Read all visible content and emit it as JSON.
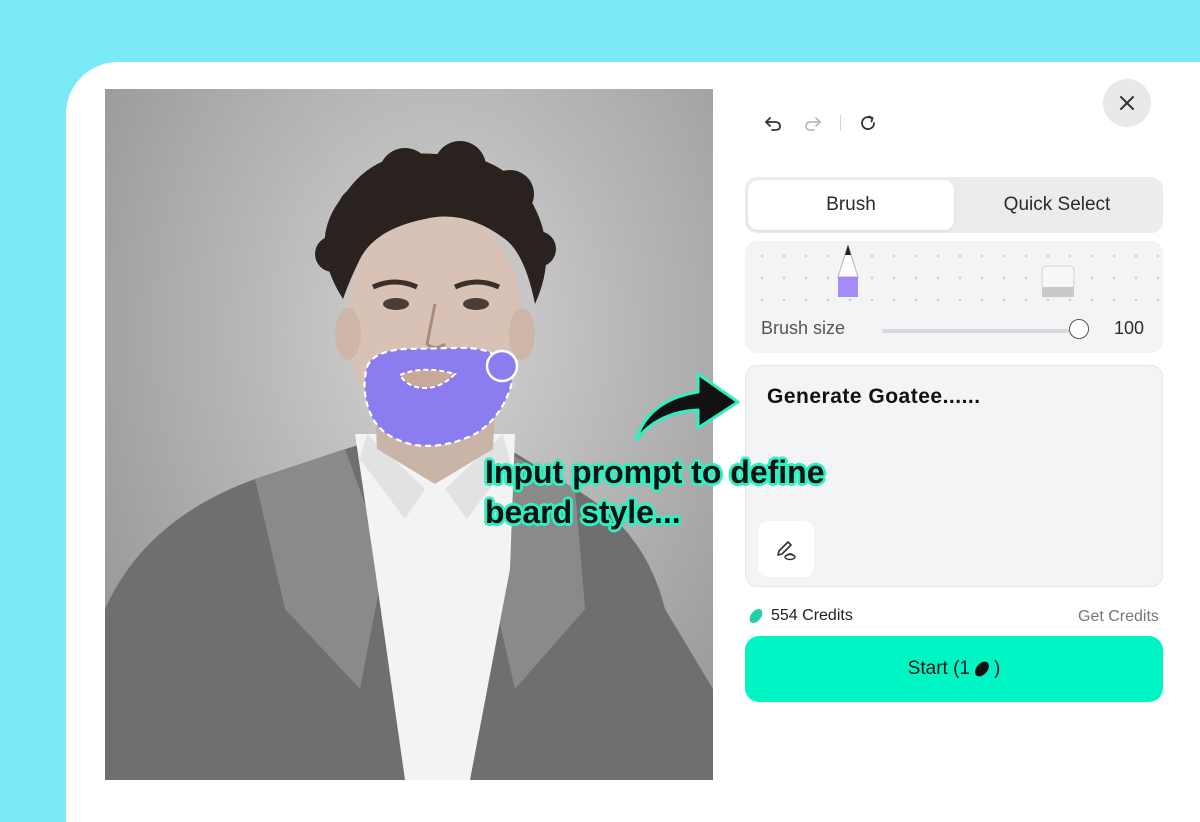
{
  "toolbar": {
    "undo_icon": "undo-icon",
    "redo_icon": "redo-icon",
    "reset_icon": "refresh-icon"
  },
  "close_icon": "close-icon",
  "tabs": [
    {
      "label": "Brush",
      "active": true
    },
    {
      "label": "Quick Select",
      "active": false
    }
  ],
  "brush": {
    "label": "Brush size",
    "value": "100",
    "tools": [
      "pencil-icon",
      "eraser-icon"
    ]
  },
  "prompt": {
    "text": "Generate Goatee......",
    "tool_icon": "pen-edit-icon"
  },
  "credits": {
    "amount_label": "554 Credits",
    "get_label": "Get Credits"
  },
  "start": {
    "label_prefix": "Start (1",
    "label_suffix": ")"
  },
  "annotation": {
    "line1": "Input prompt to define",
    "line2": "beard style..."
  },
  "colors": {
    "accent": "#00f5c4",
    "mask": "#8b7cf0",
    "background": "#7aeaf6"
  }
}
